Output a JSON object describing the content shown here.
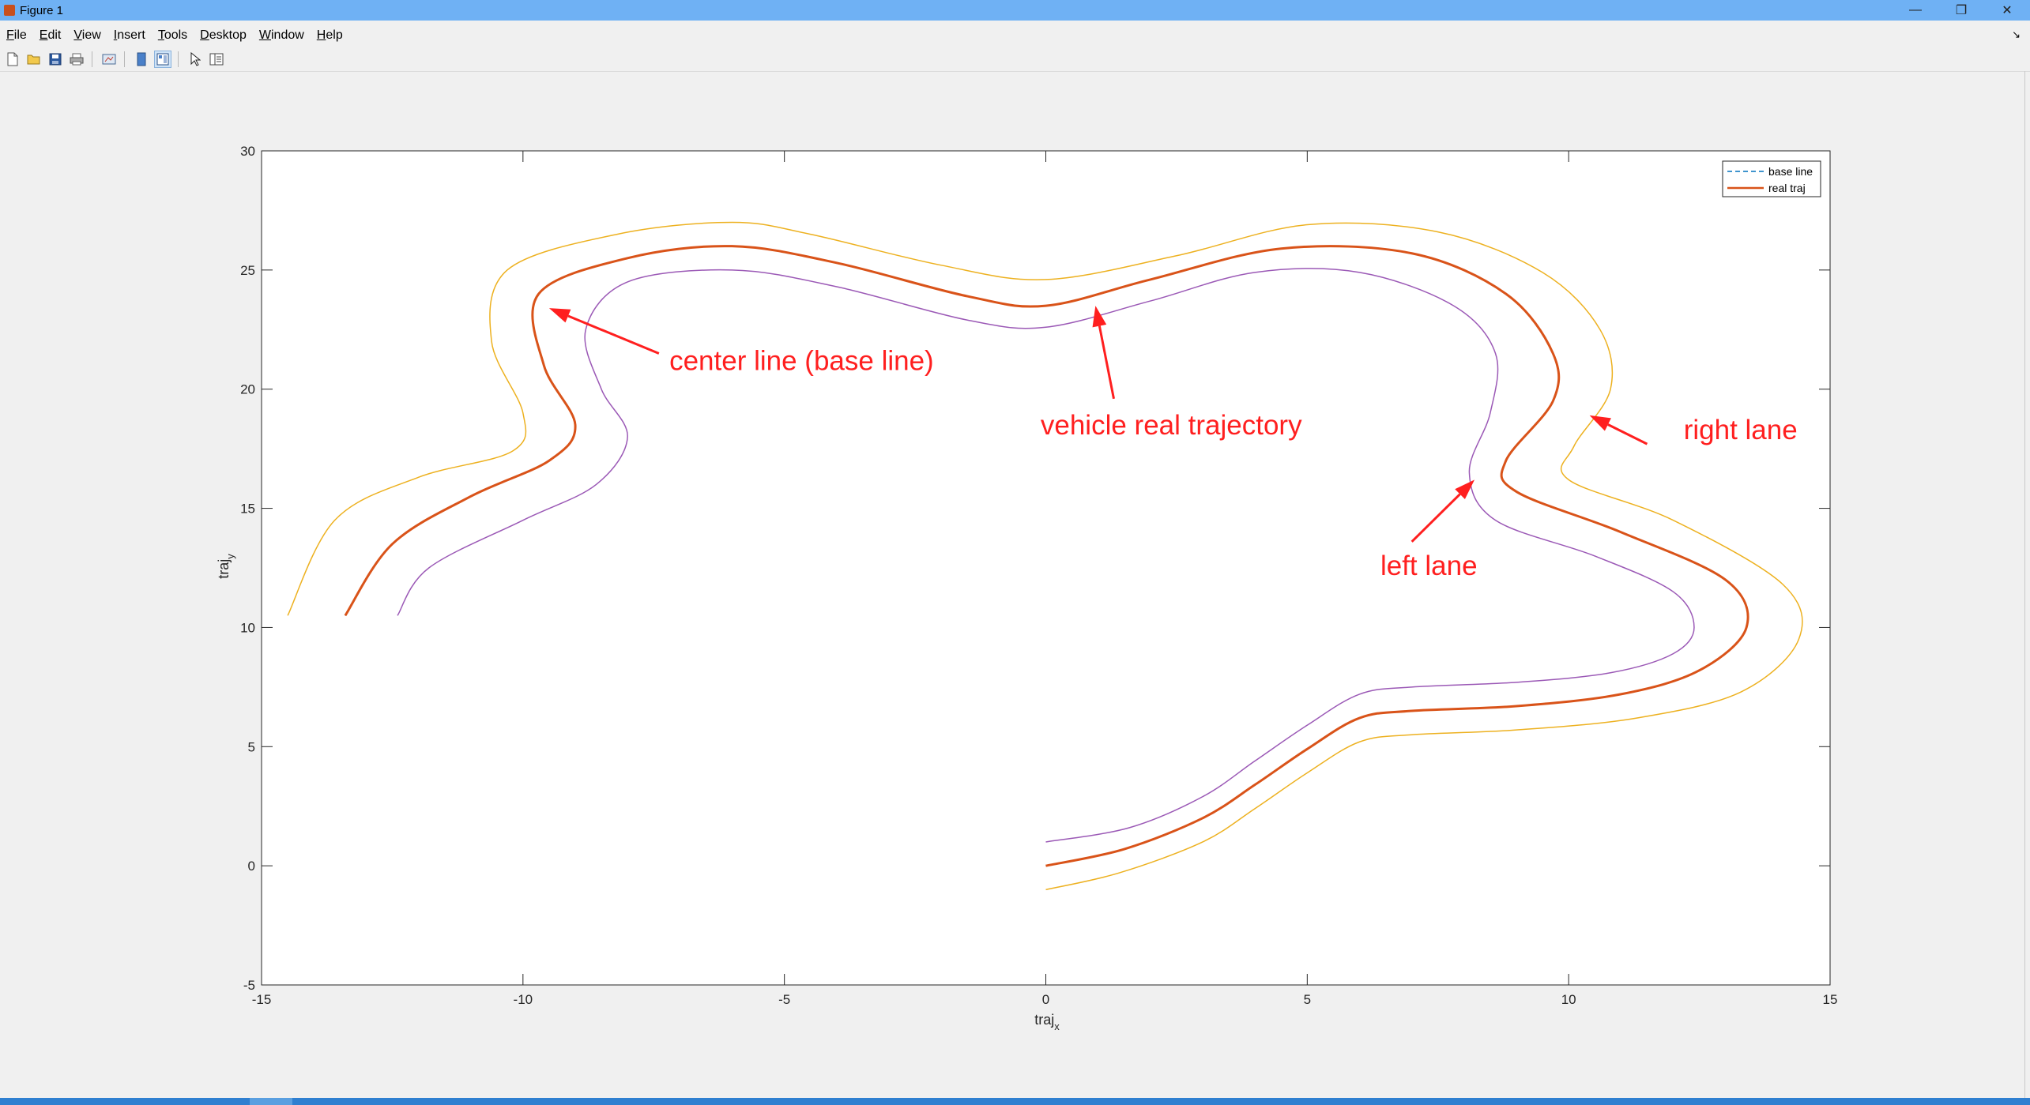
{
  "window": {
    "title": "Figure 1",
    "controls": {
      "minimize": "—",
      "restore": "❐",
      "close": "✕"
    }
  },
  "menu": {
    "items": [
      {
        "key": "F",
        "rest": "ile"
      },
      {
        "key": "E",
        "rest": "dit"
      },
      {
        "key": "V",
        "rest": "iew"
      },
      {
        "key": "I",
        "rest": "nsert"
      },
      {
        "key": "T",
        "rest": "ools"
      },
      {
        "key": "D",
        "rest": "esktop"
      },
      {
        "key": "W",
        "rest": "indow"
      },
      {
        "key": "H",
        "rest": "elp"
      }
    ],
    "pin": "↘"
  },
  "toolbar": {
    "icons": [
      "new-figure-icon",
      "open-file-icon",
      "save-icon",
      "print-icon",
      "link-plot-icon",
      "hide-plot-tools-icon",
      "show-plot-tools-icon",
      "edit-plot-icon",
      "property-inspector-icon"
    ]
  },
  "colors": {
    "center": "#d95319",
    "left": "#9b59b6",
    "right": "#edb120",
    "base": "#0072bd",
    "annotation": "#ff1f1f"
  },
  "chart_data": {
    "type": "line",
    "xlabel": "traj",
    "xlabel_sub": "x",
    "ylabel": "traj",
    "ylabel_sub": "y",
    "xlim": [
      -15,
      15
    ],
    "ylim": [
      -5,
      30
    ],
    "xticks": [
      -15,
      -10,
      -5,
      0,
      5,
      10,
      15
    ],
    "yticks": [
      -5,
      0,
      5,
      10,
      15,
      20,
      25,
      30
    ],
    "grid": false,
    "legend": {
      "placement": "top-right",
      "entries": [
        "base line",
        "real traj"
      ]
    },
    "series": [
      {
        "name": "base line",
        "style": "dashed",
        "points": [
          [
            0,
            0
          ],
          [
            1.5,
            0.7
          ],
          [
            3,
            2
          ],
          [
            4,
            3.4
          ],
          [
            5,
            4.9
          ],
          [
            6,
            6.2
          ],
          [
            7,
            6.5
          ],
          [
            9,
            6.7
          ],
          [
            11,
            7.2
          ],
          [
            12.5,
            8.2
          ],
          [
            13.4,
            10
          ],
          [
            13,
            12
          ],
          [
            11,
            14
          ],
          [
            9,
            15.7
          ],
          [
            8.8,
            17
          ],
          [
            9.7,
            19.5
          ],
          [
            9.7,
            21.5
          ],
          [
            8.8,
            24
          ],
          [
            7,
            25.7
          ],
          [
            4.5,
            25.9
          ],
          [
            2,
            24.6
          ],
          [
            0,
            23.5
          ],
          [
            -1.5,
            23.9
          ],
          [
            -4,
            25.3
          ],
          [
            -6,
            26
          ],
          [
            -8,
            25.5
          ],
          [
            -9.7,
            24
          ],
          [
            -9.6,
            21
          ],
          [
            -9,
            18.5
          ],
          [
            -9.5,
            17
          ],
          [
            -11,
            15.5
          ],
          [
            -12.5,
            13.5
          ],
          [
            -13.4,
            10.5
          ]
        ]
      },
      {
        "name": "real traj",
        "style": "solid",
        "points": [
          [
            0,
            0
          ],
          [
            1.5,
            0.7
          ],
          [
            3,
            2
          ],
          [
            4,
            3.4
          ],
          [
            5,
            4.9
          ],
          [
            6,
            6.2
          ],
          [
            7,
            6.5
          ],
          [
            9,
            6.7
          ],
          [
            11,
            7.2
          ],
          [
            12.5,
            8.2
          ],
          [
            13.4,
            10
          ],
          [
            13,
            12
          ],
          [
            11,
            14
          ],
          [
            9,
            15.7
          ],
          [
            8.8,
            17
          ],
          [
            9.7,
            19.5
          ],
          [
            9.7,
            21.5
          ],
          [
            8.8,
            24
          ],
          [
            7,
            25.7
          ],
          [
            4.5,
            25.9
          ],
          [
            2,
            24.6
          ],
          [
            0,
            23.5
          ],
          [
            -1.5,
            23.9
          ],
          [
            -4,
            25.3
          ],
          [
            -6,
            26
          ],
          [
            -8,
            25.5
          ],
          [
            -9.7,
            24
          ],
          [
            -9.6,
            21
          ],
          [
            -9,
            18.5
          ],
          [
            -9.5,
            17
          ],
          [
            -11,
            15.5
          ],
          [
            -12.5,
            13.5
          ],
          [
            -13.4,
            10.5
          ]
        ]
      },
      {
        "name": "left lane",
        "style": "solid",
        "points": [
          [
            0,
            1
          ],
          [
            1.6,
            1.6
          ],
          [
            3,
            2.9
          ],
          [
            4,
            4.4
          ],
          [
            5,
            5.9
          ],
          [
            6,
            7.2
          ],
          [
            7,
            7.5
          ],
          [
            9,
            7.7
          ],
          [
            10.8,
            8.1
          ],
          [
            12,
            8.9
          ],
          [
            12.4,
            10
          ],
          [
            12,
            11.5
          ],
          [
            10.5,
            13
          ],
          [
            8.6,
            14.5
          ],
          [
            8.1,
            16.5
          ],
          [
            8.5,
            19
          ],
          [
            8.6,
            21.5
          ],
          [
            7.8,
            23.5
          ],
          [
            6,
            24.9
          ],
          [
            4,
            24.9
          ],
          [
            2,
            23.7
          ],
          [
            0,
            22.6
          ],
          [
            -1.5,
            22.9
          ],
          [
            -4,
            24.3
          ],
          [
            -6,
            25
          ],
          [
            -8,
            24.5
          ],
          [
            -8.8,
            22.5
          ],
          [
            -8.5,
            20
          ],
          [
            -8,
            18
          ],
          [
            -8.6,
            16
          ],
          [
            -10,
            14.5
          ],
          [
            -11.8,
            12.5
          ],
          [
            -12.4,
            10.5
          ]
        ]
      },
      {
        "name": "right lane",
        "style": "solid",
        "points": [
          [
            0,
            -1
          ],
          [
            1.4,
            -0.3
          ],
          [
            3,
            1
          ],
          [
            4,
            2.4
          ],
          [
            5,
            3.9
          ],
          [
            6,
            5.2
          ],
          [
            7,
            5.5
          ],
          [
            9,
            5.7
          ],
          [
            11.3,
            6.2
          ],
          [
            13.3,
            7.3
          ],
          [
            14.4,
            9.5
          ],
          [
            14.1,
            11.8
          ],
          [
            12,
            14.5
          ],
          [
            10,
            16.2
          ],
          [
            10.1,
            17.6
          ],
          [
            10.8,
            20
          ],
          [
            10.6,
            22.5
          ],
          [
            9.5,
            24.9
          ],
          [
            7.5,
            26.6
          ],
          [
            5,
            26.9
          ],
          [
            2.5,
            25.6
          ],
          [
            0,
            24.6
          ],
          [
            -2,
            25.2
          ],
          [
            -4.5,
            26.5
          ],
          [
            -6,
            27
          ],
          [
            -8.2,
            26.5
          ],
          [
            -10.3,
            25
          ],
          [
            -10.6,
            22
          ],
          [
            -10,
            19
          ],
          [
            -10.2,
            17.4
          ],
          [
            -12,
            16.3
          ],
          [
            -13.6,
            14.5
          ],
          [
            -14.5,
            10.5
          ]
        ]
      }
    ],
    "annotations": [
      {
        "text": "center line (base line)",
        "tx": -7.2,
        "ty": 20.8,
        "ax": -9.5,
        "ay": 23.4,
        "bx": -7.4,
        "by": 21.5
      },
      {
        "text": "vehicle real trajectory",
        "tx": -0.1,
        "ty": 18.1,
        "ax": 0.95,
        "ay": 23.5,
        "bx": 1.3,
        "by": 19.6
      },
      {
        "text": "right lane",
        "tx": 12.2,
        "ty": 17.9,
        "ax": 10.4,
        "ay": 18.9,
        "bx": 11.5,
        "by": 17.7
      },
      {
        "text": "left lane",
        "tx": 6.4,
        "ty": 12.2,
        "ax": 8.2,
        "ay": 16.2,
        "bx": 7.0,
        "by": 13.6
      }
    ]
  }
}
